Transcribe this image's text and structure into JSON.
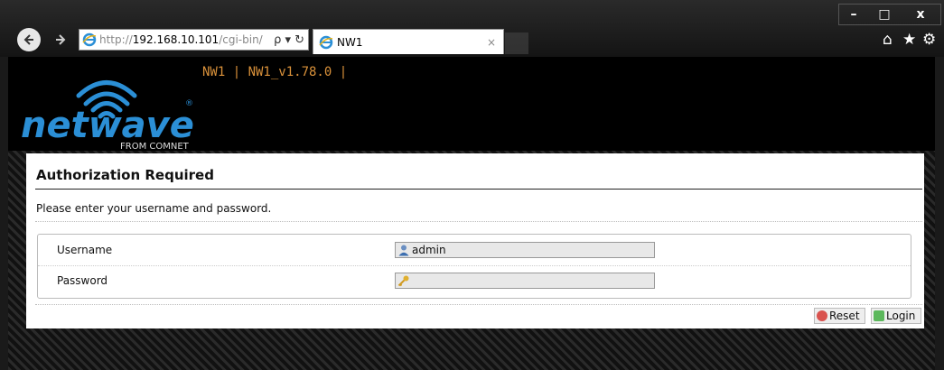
{
  "browser": {
    "window_controls": {
      "minimize": "–",
      "maximize": "□",
      "close": "x"
    },
    "nav": {
      "back_icon": "back-arrow-icon",
      "forward_icon": "forward-arrow-icon"
    },
    "address": {
      "prefix": "http://",
      "host": "192.168.10.101",
      "path": "/cgi-bin/",
      "tools": "ρ ▾ ↻"
    },
    "tab": {
      "title": "NW1",
      "close": "×"
    },
    "right_icons": {
      "home": "⌂",
      "favorites": "★",
      "tools": "⚙"
    }
  },
  "header": {
    "logo_text": "netwave",
    "logo_sub": "FROM COMNET",
    "version": "NW1 | NW1_v1.78.0 |"
  },
  "auth": {
    "title": "Authorization Required",
    "description": "Please enter your username and password.",
    "username_label": "Username",
    "username_value": "admin",
    "password_label": "Password",
    "password_value": "",
    "reset_label": "Reset",
    "login_label": "Login"
  },
  "colors": {
    "version_text": "#d9913a",
    "logo_blue": "#2b8fd6",
    "reset_icon": "#d9534f",
    "login_icon": "#5cb85c"
  }
}
